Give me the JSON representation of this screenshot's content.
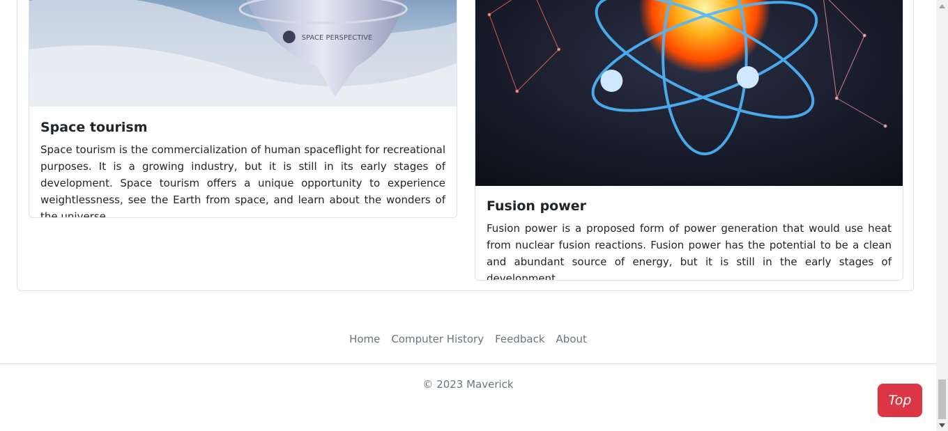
{
  "cards": [
    {
      "title": "Space tourism",
      "text": "Space tourism is the commercialization of human spaceflight for recreational purposes. It is a growing industry, but it is still in its early stages of development. Space tourism offers a unique opportunity to experience weightlessness, see the Earth from space, and learn about the wonders of the universe.",
      "image_alt": "space capsule above earth",
      "image_text": "SPACE PERSPECTIVE"
    },
    {
      "title": "Fusion power",
      "text": "Fusion power is a proposed form of power generation that would use heat from nuclear fusion reactions. Fusion power has the potential to be a clean and abundant source of energy, but it is still in the early stages of development.",
      "image_alt": "glowing atom illustration"
    }
  ],
  "footer": {
    "nav": [
      "Home",
      "Computer History",
      "Feedback",
      "About"
    ],
    "copyright": "© 2023 Maverick"
  },
  "top_button": "Top",
  "colors": {
    "accent_red": "#dc3545",
    "muted_text": "#6c757d",
    "border": "#dee2e6"
  }
}
